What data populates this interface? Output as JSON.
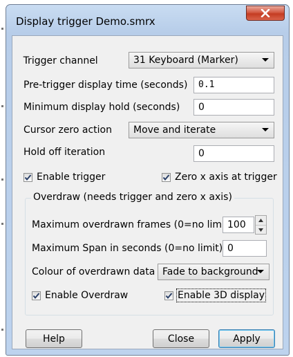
{
  "window": {
    "title": "Display trigger Demo.smrx",
    "close_symbol": "X"
  },
  "fields": {
    "trigger_channel": {
      "label": "Trigger channel",
      "value": "31 Keyboard (Marker)"
    },
    "pre_trigger": {
      "label": "Pre-trigger display time (seconds)",
      "value": "0.1"
    },
    "min_hold": {
      "label": "Minimum display hold (seconds)",
      "value": "0"
    },
    "cursor_zero": {
      "label": "Cursor zero action",
      "value": "Move and iterate"
    },
    "hold_off": {
      "label": "Hold off iteration",
      "value": "0"
    }
  },
  "checks": {
    "enable_trigger": {
      "label": "Enable trigger",
      "checked": true
    },
    "zero_x_axis": {
      "label": "Zero x axis at trigger",
      "checked": true
    }
  },
  "overdraw": {
    "title": "Overdraw (needs trigger and zero x axis)",
    "max_frames": {
      "label": "Maximum overdrawn frames (0=no limit)",
      "value": "100"
    },
    "max_span": {
      "label": "Maximum Span in seconds (0=no limit)",
      "value": "0"
    },
    "colour": {
      "label": "Colour of overdrawn data",
      "value": "Fade to background"
    },
    "enable_overdraw": {
      "label": "Enable Overdraw",
      "checked": true
    },
    "enable_3d": {
      "label": "Enable 3D display",
      "checked": true
    }
  },
  "buttons": {
    "help": "Help",
    "close": "Close",
    "apply": "Apply"
  },
  "colors": {
    "title_bar": "#bdd3ee",
    "close_button": "#c43c22",
    "dialog_bg": "#f0f0f0",
    "default_button_border": "#3c7fb1"
  },
  "icons": [
    "close-x-icon",
    "dropdown-arrow-icon",
    "checkmark-icon",
    "spin-up-icon",
    "spin-down-icon"
  ]
}
